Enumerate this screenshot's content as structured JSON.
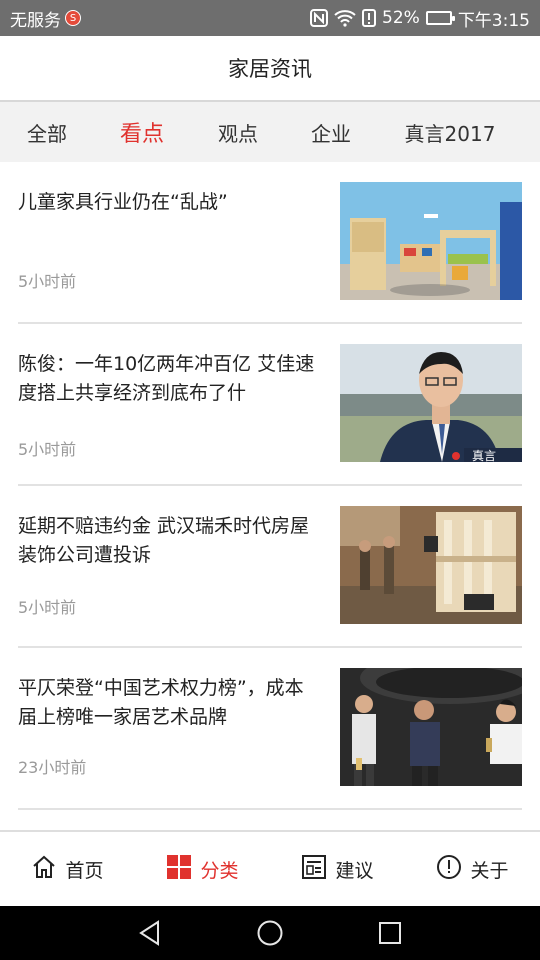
{
  "status_bar": {
    "carrier": "无服务",
    "battery": "52%",
    "battery_level": 0.52,
    "time": "下午3:15"
  },
  "header": {
    "title": "家居资讯"
  },
  "tabs": [
    {
      "label": "全部",
      "active": false
    },
    {
      "label": "看点",
      "active": true
    },
    {
      "label": "观点",
      "active": false
    },
    {
      "label": "企业",
      "active": false
    },
    {
      "label": "真言2017",
      "active": false
    }
  ],
  "news": [
    {
      "title": "儿童家具行业仍在“乱战”",
      "time": "5小时前"
    },
    {
      "title": "陈俊：一年10亿两年冲百亿 艾佳速度搭上共享经济到底布了什",
      "time": "5小时前",
      "thumb_badge": "真言"
    },
    {
      "title": "延期不赔违约金 武汉瑞禾时代房屋装饰公司遭投诉",
      "time": "5小时前"
    },
    {
      "title": "平仄荣登“中国艺术权力榜”，成本届上榜唯一家居艺术品牌",
      "time": "23小时前"
    }
  ],
  "bottom_nav": [
    {
      "label": "首页",
      "icon": "home-icon",
      "active": false
    },
    {
      "label": "分类",
      "icon": "grid-icon",
      "active": true
    },
    {
      "label": "建议",
      "icon": "feedback-icon",
      "active": false
    },
    {
      "label": "关于",
      "icon": "info-icon",
      "active": false
    }
  ],
  "colors": {
    "accent": "#e0322e",
    "status_bar": "#6e6e6e",
    "tab_bg": "#f2f2f2",
    "muted_text": "#9a9a9a"
  }
}
